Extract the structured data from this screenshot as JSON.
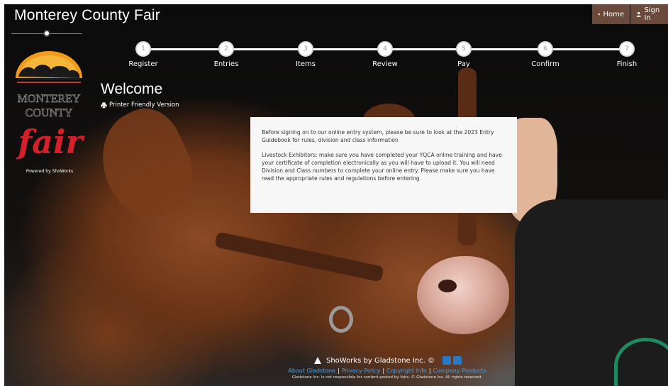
{
  "header": {
    "title": "Monterey County Fair",
    "home_label": "Home",
    "signin_label": "Sign In",
    "nav_color": "#6b4a3c"
  },
  "sidebar": {
    "powered_by": "Powered by ShoWorks",
    "logo_alt": "Monterey County Fair logo"
  },
  "steps": [
    {
      "number": "1",
      "label": "Register"
    },
    {
      "number": "2",
      "label": "Entries"
    },
    {
      "number": "3",
      "label": "Items"
    },
    {
      "number": "4",
      "label": "Review"
    },
    {
      "number": "5",
      "label": "Pay"
    },
    {
      "number": "6",
      "label": "Confirm"
    },
    {
      "number": "7",
      "label": "Finish"
    }
  ],
  "main": {
    "heading": "Welcome",
    "printer_link": "Printer Friendly Version",
    "info_paragraph_1": " Before signing on to our online entry system, please be sure to look at the 2023 Entry Guidebook for rules, division and class information",
    "info_paragraph_2": "Livestock Exhibitors: make sure you have completed your YQCA online training and have your certificate of completion electronically as you will have to upload it. You will need Division and Class numbers to complete your online entry. Please make sure you have read the appropriate rules and regulations before entering."
  },
  "footer": {
    "brand": "ShoWorks by Gladstone Inc. ©",
    "links": [
      "About Gladstone",
      "Privacy Policy",
      "Copyright Info",
      "Company Products"
    ],
    "disclaimer": "Gladstone Inc. is not responsible for content posted by fairs. © Gladstone Inc. All rights reserved.",
    "link_color": "#4aa0e8"
  },
  "icons": {
    "home": "home-icon",
    "user": "user-icon",
    "printer": "printer-icon",
    "showorks": "showorks-logo-icon",
    "twitter": "twitter-icon",
    "facebook": "facebook-icon"
  }
}
